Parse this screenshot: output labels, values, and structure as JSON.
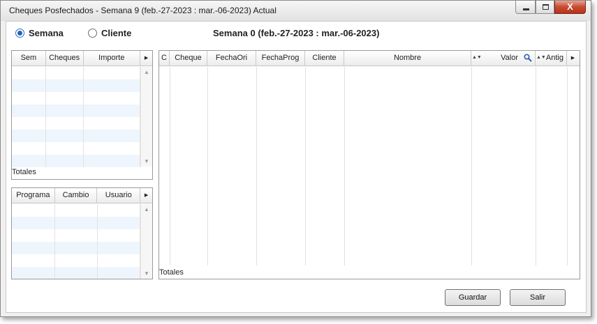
{
  "window": {
    "title": "Cheques Posfechados  -  Semana 9 (feb.-27-2023 : mar.-06-2023)  Actual",
    "close_glyph": "X"
  },
  "mode": {
    "options": [
      "Semana",
      "Cliente"
    ],
    "selected": "Semana"
  },
  "heading": "Semana 0 (feb.-27-2023 : mar.-06-2023)",
  "weeks_grid": {
    "columns": [
      "Sem",
      "Cheques",
      "Importe"
    ],
    "totals_label": "Totales"
  },
  "changes_grid": {
    "columns": [
      "Programa",
      "Cambio",
      "Usuario"
    ]
  },
  "cheques_grid": {
    "columns": [
      "C",
      "Cheque",
      "FechaOri",
      "FechaProg",
      "Cliente",
      "Nombre",
      "Valor",
      "Antig"
    ],
    "totals_label": "Totales"
  },
  "buttons": {
    "save": "Guardar",
    "exit": "Salir"
  },
  "icons": {
    "header_more": "caret-right-icon",
    "scroll_up": "scroll-up-icon",
    "scroll_down": "scroll-down-icon",
    "search": "search-icon",
    "sort": "sort-icon"
  },
  "colors": {
    "alt_row": "#eef5fd",
    "radio_accent": "#2563b8",
    "close_button": "#c74a31"
  }
}
